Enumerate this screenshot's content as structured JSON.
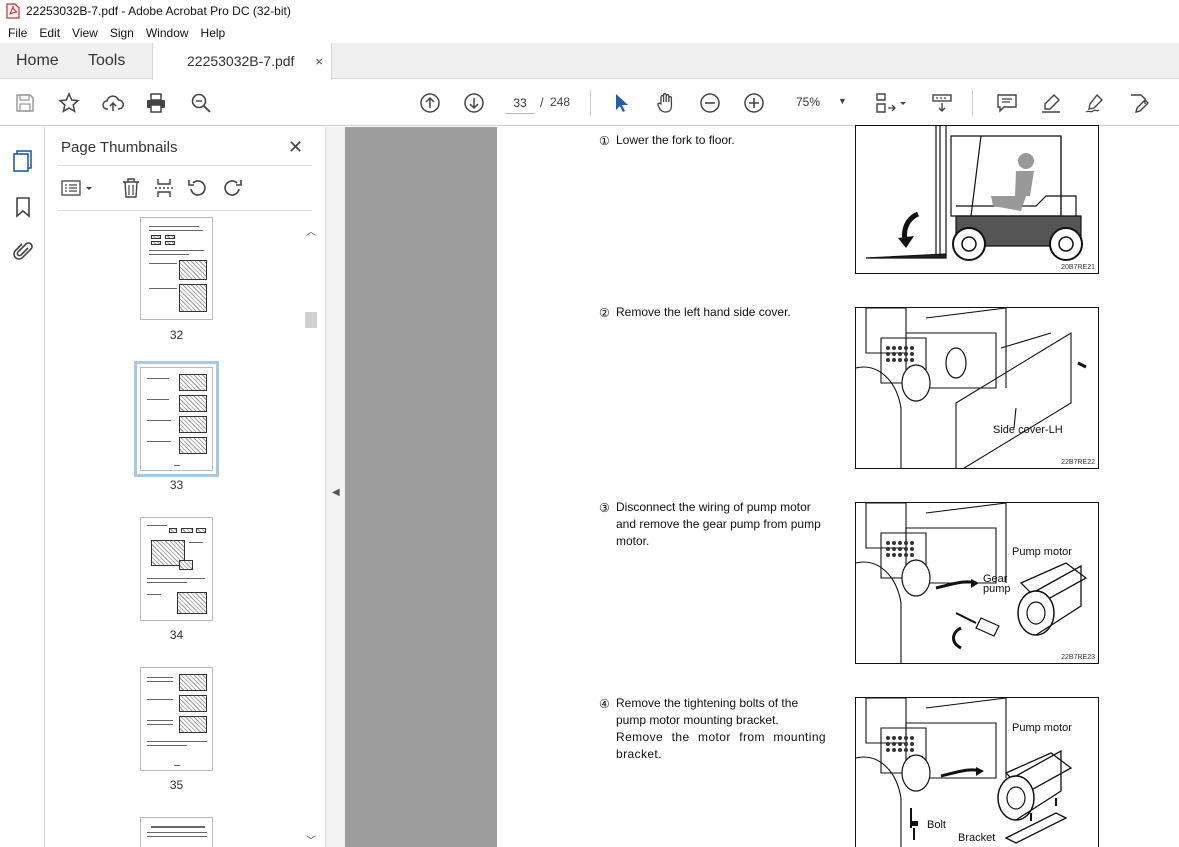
{
  "window": {
    "title": "22253032B-7.pdf - Adobe Acrobat Pro DC (32-bit)"
  },
  "menu": [
    "File",
    "Edit",
    "View",
    "Sign",
    "Window",
    "Help"
  ],
  "tabs": {
    "home": "Home",
    "tools": "Tools",
    "document": "22253032B-7.pdf",
    "close_glyph": "×"
  },
  "toolbar": {
    "current_page": "33",
    "page_separator": "/",
    "total_pages": "248",
    "zoom": "75%"
  },
  "thumbnails_panel": {
    "title": "Page Thumbnails",
    "pages": [
      {
        "label": "32",
        "selected": false
      },
      {
        "label": "33",
        "selected": true
      },
      {
        "label": "34",
        "selected": false
      },
      {
        "label": "35",
        "selected": false
      }
    ]
  },
  "document": {
    "steps": [
      {
        "number": "①",
        "text": "Lower the fork to floor.",
        "figure_code": "20B7RE21",
        "labels": []
      },
      {
        "number": "②",
        "text": "Remove the left hand side cover.",
        "figure_code": "22B7RE22",
        "labels": [
          "Side cover-LH"
        ]
      },
      {
        "number": "③",
        "text": "Disconnect the wiring of pump motor and remove the gear pump from pump motor.",
        "figure_code": "22B7RE23",
        "labels": [
          "Pump motor",
          "Gear",
          "pump"
        ]
      },
      {
        "number": "④",
        "text": "Remove the tightening bolts of the pump motor mounting bracket.",
        "text2": "Remove the motor from mounting bracket.",
        "figure_code": "",
        "labels": [
          "Pump motor",
          "Bolt",
          "Bracket"
        ]
      }
    ]
  },
  "colors": {
    "gutter": "#9d9d9d",
    "tab_bar": "#f0f0f0",
    "selected_thumb_outline": "#a6c8e8",
    "pointer_blue": "#1a5fb4",
    "acrobat_red": "#d7262a"
  }
}
